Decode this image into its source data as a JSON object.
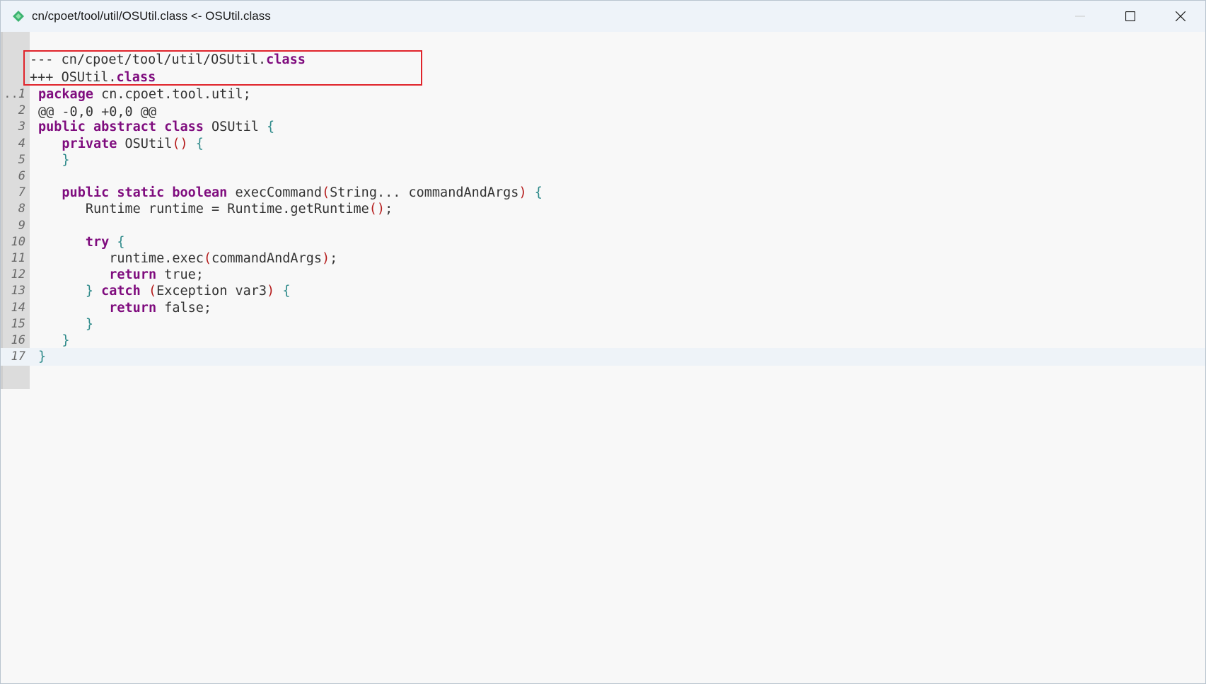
{
  "window": {
    "title": "cn/cpoet/tool/util/OSUtil.class <- OSUtil.class",
    "icon": "diff-app-icon",
    "controls": [
      "minimize",
      "maximize",
      "close"
    ]
  },
  "diff_header": {
    "minus_prefix": "--- ",
    "minus_path": "cn/cpoet/tool/util/OSUtil.",
    "minus_ext": "class",
    "plus_prefix": "+++ ",
    "plus_path": "OSUtil.",
    "plus_ext": "class",
    "hunk": "@@ -0,0 +0,0 @@",
    "gutter_marker": "..."
  },
  "code_lines": [
    {
      "n": "1",
      "tokens": [
        [
          "kw",
          "package"
        ],
        [
          "t",
          " cn.cpoet.tool.util;"
        ]
      ]
    },
    {
      "n": "2",
      "tokens": []
    },
    {
      "n": "3",
      "tokens": [
        [
          "kw",
          "public abstract class"
        ],
        [
          "t",
          " OSUtil "
        ],
        [
          "brc",
          "{"
        ]
      ]
    },
    {
      "n": "4",
      "tokens": [
        [
          "t",
          "   "
        ],
        [
          "kw",
          "private"
        ],
        [
          "t",
          " OSUtil"
        ],
        [
          "par",
          "()"
        ],
        [
          "t",
          " "
        ],
        [
          "brc",
          "{"
        ]
      ]
    },
    {
      "n": "5",
      "tokens": [
        [
          "t",
          "   "
        ],
        [
          "brc",
          "}"
        ]
      ]
    },
    {
      "n": "6",
      "tokens": []
    },
    {
      "n": "7",
      "tokens": [
        [
          "t",
          "   "
        ],
        [
          "kw",
          "public static boolean"
        ],
        [
          "t",
          " execCommand"
        ],
        [
          "par",
          "("
        ],
        [
          "t",
          "String... commandAndArgs"
        ],
        [
          "par",
          ")"
        ],
        [
          "t",
          " "
        ],
        [
          "brc",
          "{"
        ]
      ]
    },
    {
      "n": "8",
      "tokens": [
        [
          "t",
          "      Runtime runtime = Runtime.getRuntime"
        ],
        [
          "par",
          "()"
        ],
        [
          "t",
          ";"
        ]
      ]
    },
    {
      "n": "9",
      "tokens": []
    },
    {
      "n": "10",
      "tokens": [
        [
          "t",
          "      "
        ],
        [
          "kw",
          "try"
        ],
        [
          "t",
          " "
        ],
        [
          "brc",
          "{"
        ]
      ]
    },
    {
      "n": "11",
      "tokens": [
        [
          "t",
          "         runtime.exec"
        ],
        [
          "par",
          "("
        ],
        [
          "t",
          "commandAndArgs"
        ],
        [
          "par",
          ")"
        ],
        [
          "t",
          ";"
        ]
      ]
    },
    {
      "n": "12",
      "tokens": [
        [
          "t",
          "         "
        ],
        [
          "kw",
          "return"
        ],
        [
          "t",
          " true;"
        ]
      ]
    },
    {
      "n": "13",
      "tokens": [
        [
          "t",
          "      "
        ],
        [
          "brc",
          "}"
        ],
        [
          "t",
          " "
        ],
        [
          "kw",
          "catch"
        ],
        [
          "t",
          " "
        ],
        [
          "par",
          "("
        ],
        [
          "t",
          "Exception var3"
        ],
        [
          "par",
          ")"
        ],
        [
          "t",
          " "
        ],
        [
          "brc",
          "{"
        ]
      ]
    },
    {
      "n": "14",
      "tokens": [
        [
          "t",
          "         "
        ],
        [
          "kw",
          "return"
        ],
        [
          "t",
          " false;"
        ]
      ]
    },
    {
      "n": "15",
      "tokens": [
        [
          "t",
          "      "
        ],
        [
          "brc",
          "}"
        ]
      ]
    },
    {
      "n": "16",
      "tokens": [
        [
          "t",
          "   "
        ],
        [
          "brc",
          "}"
        ]
      ]
    },
    {
      "n": "17",
      "tokens": [
        [
          "brc",
          "}"
        ]
      ]
    }
  ],
  "current_line": "17",
  "colors": {
    "keyword": "#7f0c7e",
    "paren": "#b51c1c",
    "brace": "#2e8a8a",
    "highlight_box": "#e0242b"
  }
}
